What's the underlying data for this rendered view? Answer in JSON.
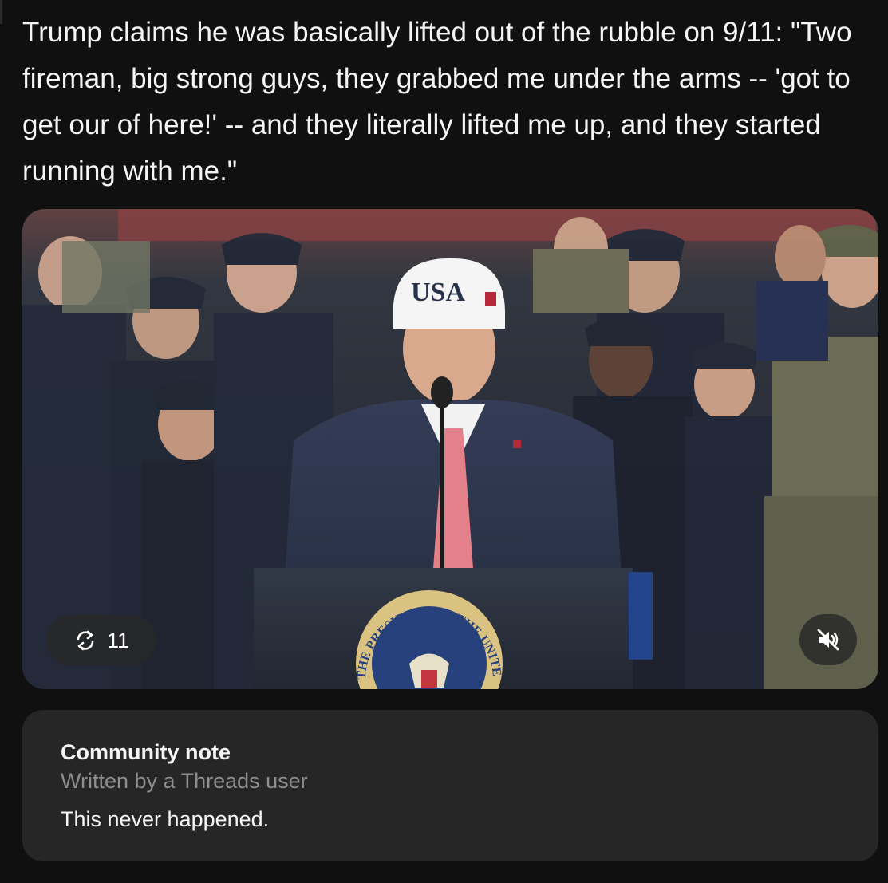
{
  "post": {
    "text": "Trump claims he was basically lifted out of the rubble on 9/11: \"Two fireman, big strong guys, they grabbed me under the arms -- 'got to get our of here!' -- and they literally lifted me up, and they started running with me.\""
  },
  "media": {
    "cap_text": "USA",
    "seal_text": "THE PRESIDENT OF THE UNITED",
    "repost_count": "11",
    "repost_icon": "repost-icon",
    "mute_icon": "speaker-muted-icon"
  },
  "community_note": {
    "title": "Community note",
    "subtitle": "Written by a Threads user",
    "body": "This never happened."
  },
  "colors": {
    "background": "#101010",
    "card": "#262626",
    "text_primary": "#f3f5f7",
    "text_secondary": "#8e8e8e"
  }
}
